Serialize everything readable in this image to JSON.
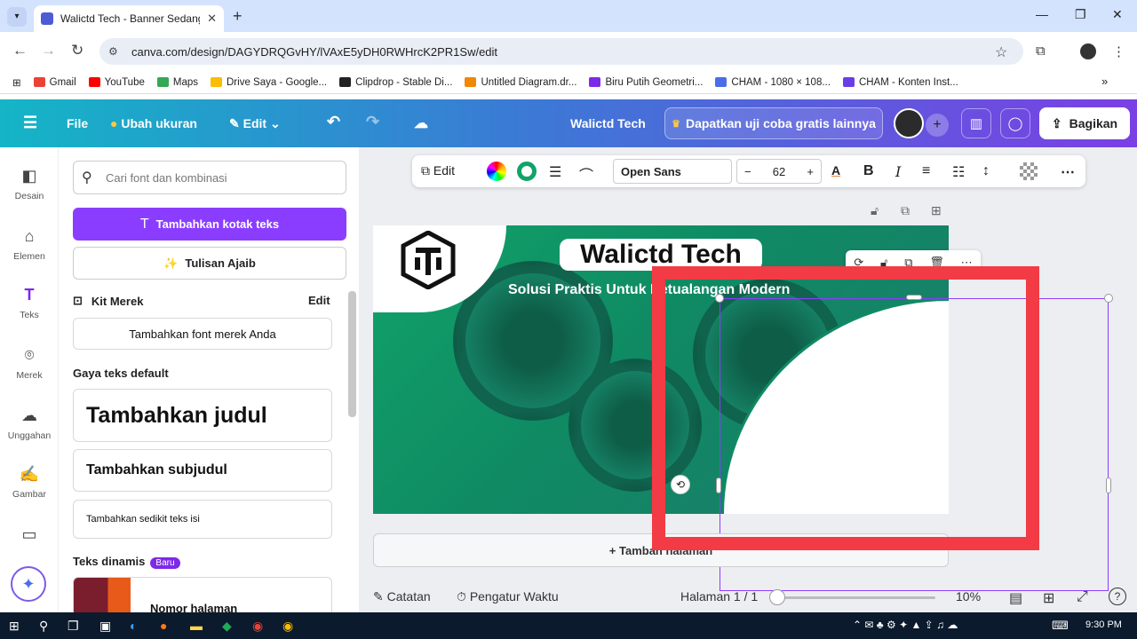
{
  "browser": {
    "tab_title": "Walictd Tech - Banner Sedang (",
    "url": "canva.com/design/DAGYDRQGvHY/lVAxE5yDH0RWHrcK2PR1Sw/edit",
    "bookmarks": [
      "Gmail",
      "YouTube",
      "Maps",
      "Drive Saya - Google...",
      "Clipdrop - Stable Di...",
      "Untitled Diagram.dr...",
      "Biru Putih Geometri...",
      "CHAM - 1080 × 108...",
      "CHAM - Konten Inst..."
    ]
  },
  "header": {
    "file": "File",
    "resize": "Ubah ukuran",
    "edit": "Edit",
    "doc_title": "Walictd Tech",
    "trial": "Dapatkan uji coba gratis lainnya",
    "share": "Bagikan"
  },
  "rail": {
    "items": [
      "Desain",
      "Elemen",
      "Teks",
      "Merek",
      "Unggahan",
      "Gambar"
    ]
  },
  "panel": {
    "search_placeholder": "Cari font dan kombinasi",
    "add_text_box": "Tambahkan kotak teks",
    "magic_write": "Tulisan Ajaib",
    "brand_kit": "Kit Merek",
    "brand_edit": "Edit",
    "add_brand_font": "Tambahkan font merek Anda",
    "default_styles": "Gaya teks default",
    "add_heading": "Tambahkan judul",
    "add_subheading": "Tambahkan subjudul",
    "add_body": "Tambahkan sedikit teks isi",
    "dynamic_text": "Teks dinamis",
    "new_badge": "Baru",
    "page_number": "Nomor halaman"
  },
  "toolbar": {
    "edit": "Edit",
    "font": "Open Sans",
    "size": "62",
    "minus": "−",
    "plus": "+",
    "bold": "B",
    "italic": "I"
  },
  "canvas": {
    "title": "Walictd Tech",
    "subtitle": "Solusi Praktis Untuk Petualangan Modern",
    "add_page": "+ Tambah halaman"
  },
  "footer": {
    "notes": "Catatan",
    "timer": "Pengatur Waktu",
    "page": "Halaman 1 / 1",
    "zoom": "10%"
  },
  "taskbar": {
    "time": "9:30 PM"
  },
  "colors": {
    "accent": "#8b3dff",
    "annotation": "#f23b44",
    "banner": "#11a36a"
  }
}
